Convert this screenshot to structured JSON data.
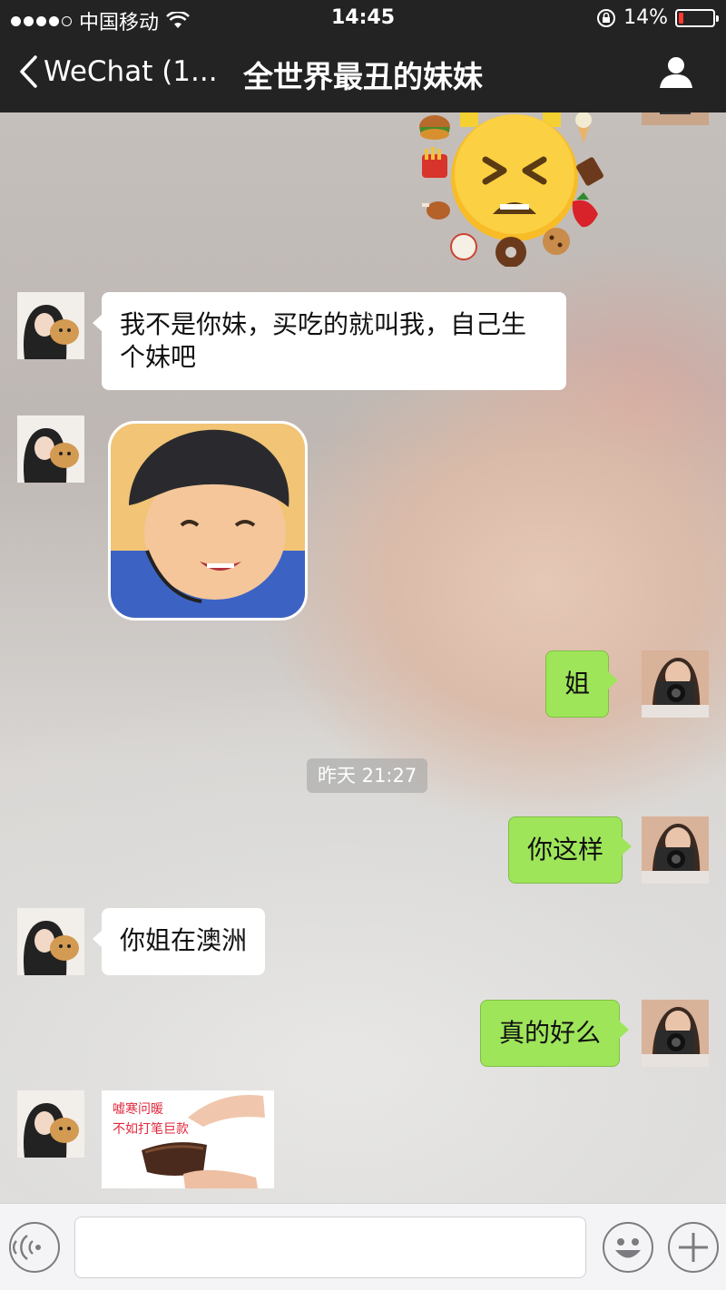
{
  "status_bar": {
    "carrier": "中国移动",
    "time": "14:45",
    "battery_percent": "14%",
    "battery_level": 0.14,
    "signal_bars_filled": 4,
    "signal_bars_total": 5
  },
  "nav": {
    "back_label": "WeChat (1...",
    "title": "全世界最丑的妹妹"
  },
  "messages": [
    {
      "side": "right",
      "type": "sticker",
      "icon": "tired-face-food-emoji-sticker"
    },
    {
      "side": "left",
      "type": "text",
      "text": "我不是你妹，买吃的就叫我，自己生个妹吧"
    },
    {
      "side": "left",
      "type": "sticker",
      "icon": "smiling-child-photo-sticker"
    },
    {
      "side": "right",
      "type": "text",
      "text": "姐"
    },
    {
      "side": "right",
      "type": "text",
      "text": "你这样"
    },
    {
      "side": "left",
      "type": "text",
      "text": "你姐在澳洲"
    },
    {
      "side": "right",
      "type": "text",
      "text": "真的好么"
    },
    {
      "side": "left",
      "type": "sticker",
      "icon": "wallet-hands-sticker",
      "caption_line1": "嘘寒问暖",
      "caption_line2": "不如打笔巨款"
    }
  ],
  "timestamp": "昨天 21:27",
  "input_bar": {
    "voice_icon": "voice-icon",
    "emoji_icon": "emoji-icon",
    "plus_icon": "plus-icon"
  },
  "colors": {
    "bar_bg": "#232323",
    "green_bubble": "#9fe55a",
    "white_bubble": "#ffffff",
    "battery_low": "#ff3b30"
  }
}
